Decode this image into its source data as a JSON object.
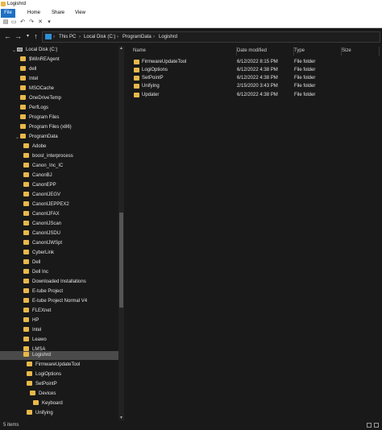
{
  "window": {
    "title": "Logishrd"
  },
  "ribbon": {
    "tabs": [
      "File",
      "Home",
      "Share",
      "View"
    ]
  },
  "address": {
    "crumbs": [
      "This PC",
      "Local Disk (C:)",
      "ProgramData",
      "Logishrd"
    ]
  },
  "nav": {
    "items": [
      {
        "label": "Local Disk (C:)",
        "kind": "drive"
      },
      {
        "label": "$WinREAgent"
      },
      {
        "label": "dell"
      },
      {
        "label": "Intel"
      },
      {
        "label": "MSOCache"
      },
      {
        "label": "OneDriveTemp"
      },
      {
        "label": "PerfLogs"
      },
      {
        "label": "Program Files"
      },
      {
        "label": "Program Files (x86)"
      },
      {
        "label": "ProgramData"
      },
      {
        "label": "Adobe"
      },
      {
        "label": "boost_interprocess"
      },
      {
        "label": "Canon_Inc_IC"
      },
      {
        "label": "CanonBJ"
      },
      {
        "label": "CanonEPP"
      },
      {
        "label": "CanonIJEGV"
      },
      {
        "label": "CanonIJEPPEX2"
      },
      {
        "label": "CanonIJFAX"
      },
      {
        "label": "CanonIJScan"
      },
      {
        "label": "CanonIJSDU"
      },
      {
        "label": "CanonIJWSpt"
      },
      {
        "label": "CyberLink"
      },
      {
        "label": "Dell"
      },
      {
        "label": "Dell Inc"
      },
      {
        "label": "Downloaded Installations"
      },
      {
        "label": "E-tube Project"
      },
      {
        "label": "E-tube Project Normal V4"
      },
      {
        "label": "FLEXnet"
      },
      {
        "label": "HP"
      },
      {
        "label": "Intel"
      },
      {
        "label": "Leawo"
      },
      {
        "label": "LMSA"
      },
      {
        "label": "Logishrd"
      },
      {
        "label": "FirmwareUpdateTool"
      },
      {
        "label": "LogiOptions"
      },
      {
        "label": "SetPointP"
      },
      {
        "label": "Devices"
      },
      {
        "label": "Keyboard"
      },
      {
        "label": "Unifying"
      }
    ]
  },
  "columns": [
    "Name",
    "Date modified",
    "Type",
    "Size"
  ],
  "files": [
    {
      "name": "FirmwareUpdateTool",
      "date": "6/12/2022 8:15 PM",
      "type": "File folder"
    },
    {
      "name": "LogiOptions",
      "date": "6/12/2022 4:38 PM",
      "type": "File folder"
    },
    {
      "name": "SetPointP",
      "date": "6/12/2022 4:38 PM",
      "type": "File folder"
    },
    {
      "name": "Unifying",
      "date": "2/15/2020 3:43 PM",
      "type": "File folder"
    },
    {
      "name": "Updater",
      "date": "6/12/2022 4:38 PM",
      "type": "File folder"
    }
  ],
  "status": {
    "items": "5 items"
  },
  "colors": {
    "folder": "#e8b84a",
    "accent": "#1f6fc4",
    "background": "#191919"
  }
}
